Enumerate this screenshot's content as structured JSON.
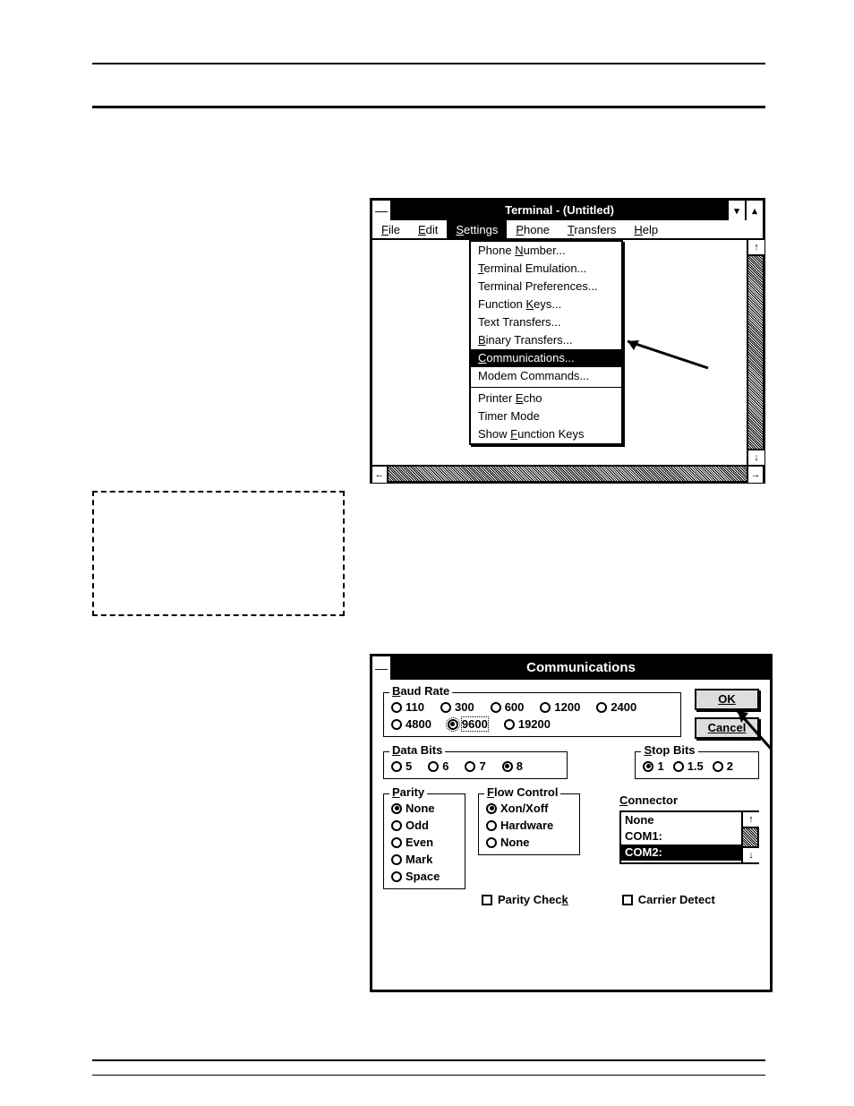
{
  "terminal": {
    "title": "Terminal - (Untitled)",
    "sysmenu_glyph": "—",
    "min_glyph": "▾",
    "max_glyph": "▴",
    "menubar": [
      "File",
      "Edit",
      "Settings",
      "Phone",
      "Transfers",
      "Help"
    ],
    "open_menu_index": 2,
    "menubar_underline_chars": [
      "F",
      "E",
      "S",
      "P",
      "T",
      "H"
    ],
    "dropdown": {
      "groups": [
        [
          "Phone Number...",
          "Terminal Emulation...",
          "Terminal Preferences...",
          "Function Keys...",
          "Text Transfers...",
          "Binary Transfers...",
          "Communications...",
          "Modem Commands..."
        ],
        [
          "Printer Echo",
          "Timer Mode",
          "Show Function Keys"
        ]
      ],
      "underline": [
        "N",
        "T",
        "",
        "K",
        "",
        "B",
        "C",
        "",
        "",
        " E",
        "",
        "F"
      ],
      "highlighted": "Communications..."
    },
    "scroll": {
      "up": "↑",
      "down": "↓",
      "left": "←",
      "right": "→"
    }
  },
  "communications": {
    "title": "Communications",
    "ok_label": "OK",
    "cancel_label": "Cancel",
    "baud": {
      "legend": "Baud Rate",
      "legend_underline": "B",
      "options": [
        "110",
        "300",
        "600",
        "1200",
        "2400",
        "4800",
        "9600",
        "19200"
      ],
      "selected": "9600"
    },
    "data_bits": {
      "legend": "Data Bits",
      "legend_underline": "D",
      "options": [
        "5",
        "6",
        "7",
        "8"
      ],
      "selected": "8"
    },
    "stop_bits": {
      "legend": "Stop Bits",
      "legend_underline": "S",
      "options": [
        "1",
        "1.5",
        "2"
      ],
      "selected": "1"
    },
    "parity": {
      "legend": "Parity",
      "legend_underline": "P",
      "options": [
        "None",
        "Odd",
        "Even",
        "Mark",
        "Space"
      ],
      "selected": "None"
    },
    "flow": {
      "legend": "Flow Control",
      "legend_underline": "F",
      "options": [
        "Xon/Xoff",
        "Hardware",
        "None"
      ],
      "selected": "Xon/Xoff"
    },
    "connector": {
      "label": "Connector",
      "label_underline": "C",
      "items": [
        "None",
        "COM1:",
        "COM2:"
      ],
      "selected": "COM2:"
    },
    "parity_check": {
      "label": "Parity Check",
      "underline": "k",
      "checked": false
    },
    "carrier_detect": {
      "label": "Carrier Detect",
      "checked": false
    }
  }
}
